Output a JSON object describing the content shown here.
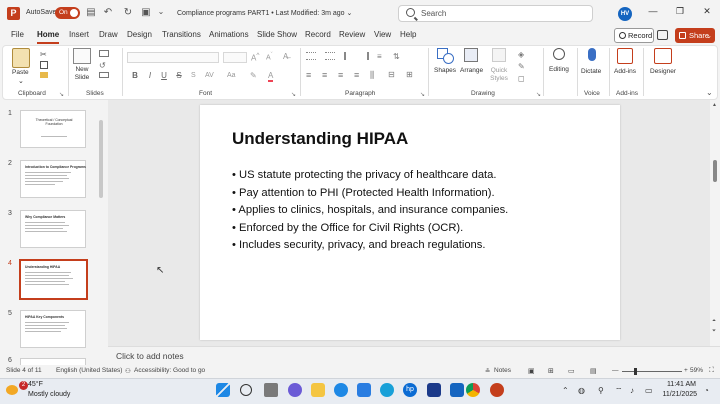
{
  "title_bar": {
    "autosave_label": "AutoSave",
    "autosave_state": "On",
    "document_title": "Compliance programs PART1 • Last Modified: 3m ago ⌄",
    "search_placeholder": "Search",
    "user_initials": "HV",
    "minimize_glyph": "—",
    "restore_glyph": "❐",
    "close_glyph": "✕"
  },
  "tabs": [
    "File",
    "Home",
    "Insert",
    "Draw",
    "Design",
    "Transitions",
    "Animations",
    "Slide Show",
    "Record",
    "Review",
    "View",
    "Help"
  ],
  "active_tab": "Home",
  "record_label": "Record",
  "share_label": "Share",
  "ribbon": {
    "clipboard": {
      "paste_label": "Paste",
      "group_label": "Clipboard"
    },
    "slides": {
      "new_slide_label": "New Slide",
      "group_label": "Slides"
    },
    "font": {
      "group_label": "Font",
      "bold": "B",
      "italic": "I",
      "underline": "U",
      "strike": "S"
    },
    "paragraph": {
      "group_label": "Paragraph"
    },
    "drawing": {
      "shapes_label": "Shapes",
      "arrange_label": "Arrange",
      "quick_styles_label": "Quick Styles",
      "group_label": "Drawing"
    },
    "editing": {
      "label": "Editing"
    },
    "voice": {
      "dictate_label": "Dictate",
      "group_label": "Voice"
    },
    "addins": {
      "addins_label": "Add-ins",
      "group_label": "Add-ins"
    },
    "designer": {
      "label": "Designer"
    }
  },
  "thumbnails": [
    {
      "number": "1",
      "title": "Theoretical / Conceptual Foundation",
      "centered": true
    },
    {
      "number": "2",
      "title": "Introduction to Compliance Programs"
    },
    {
      "number": "3",
      "title": "Why Compliance Matters"
    },
    {
      "number": "4",
      "title": "Understanding HIPAA",
      "selected": true
    },
    {
      "number": "5",
      "title": "HIPAA Key Components"
    },
    {
      "number": "6",
      "title": ""
    }
  ],
  "slide": {
    "title": "Understanding HIPAA",
    "bullets": [
      "• US statute protecting the privacy of healthcare data.",
      "• Pay attention to PHI (Protected Health Information).",
      "• Applies to clinics, hospitals, and insurance companies.",
      "• Enforced by the Office for Civil Rights (OCR).",
      "• Includes security, privacy, and breach regulations."
    ]
  },
  "notes_placeholder": "Click to add notes",
  "status_bar": {
    "slide_info": "Slide 4 of 11",
    "language": "English (United States)",
    "accessibility": "Accessibility: Good to go",
    "notes_label": "Notes",
    "zoom": "59%"
  },
  "taskbar": {
    "weather_badge": "2",
    "temperature": "45°F",
    "weather_desc": "Mostly cloudy",
    "time": "11:41 AM",
    "date": "11/21/2025"
  },
  "colors": {
    "accent": "#c43e1c",
    "avatar": "#1565c0"
  }
}
